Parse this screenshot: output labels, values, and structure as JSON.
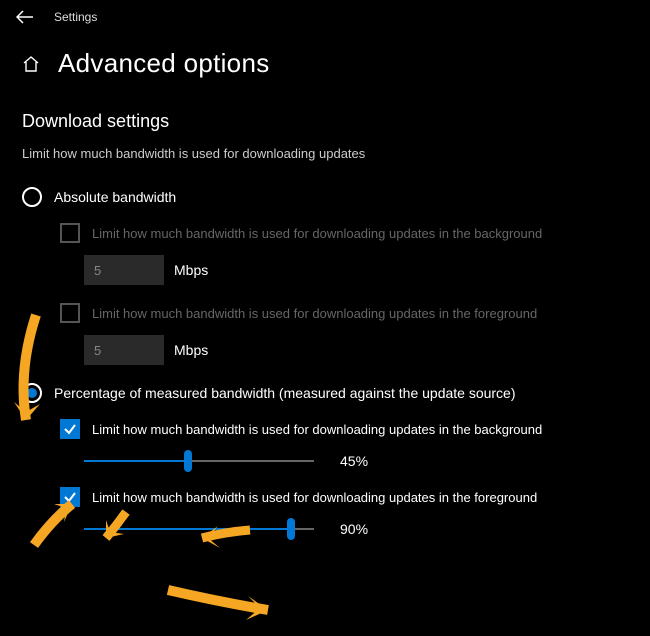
{
  "topbar": {
    "app_title": "Settings"
  },
  "header": {
    "title": "Advanced options"
  },
  "section": {
    "title": "Download settings",
    "description": "Limit how much bandwidth is used for downloading updates"
  },
  "absolute": {
    "label": "Absolute bandwidth",
    "bg_check_label": "Limit how much bandwidth is used for downloading updates in the background",
    "bg_value": "5",
    "bg_unit": "Mbps",
    "fg_check_label": "Limit how much bandwidth is used for downloading updates in the foreground",
    "fg_value": "5",
    "fg_unit": "Mbps"
  },
  "percentage": {
    "label": "Percentage of measured bandwidth (measured against the update source)",
    "bg_check_label": "Limit how much bandwidth is used for downloading updates in the background",
    "bg_slider_value": "45%",
    "bg_slider_percent": 45,
    "fg_check_label": "Limit how much bandwidth is used for downloading updates in the foreground",
    "fg_slider_value": "90%",
    "fg_slider_percent": 90
  }
}
